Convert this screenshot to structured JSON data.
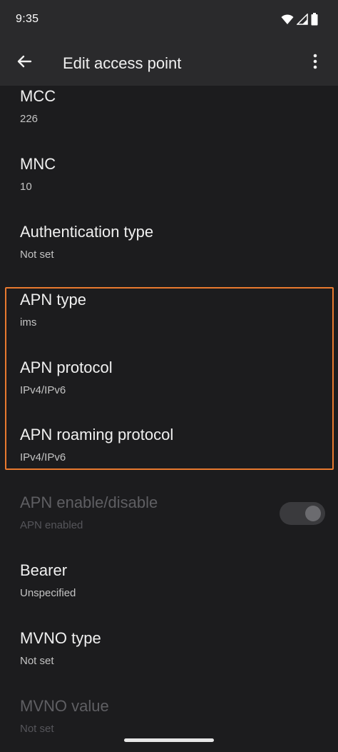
{
  "status_bar": {
    "time": "9:35",
    "icons": [
      "wifi-icon",
      "signal-icon",
      "battery-icon"
    ]
  },
  "app_bar": {
    "title": "Edit access point",
    "back_icon": "arrow-back-icon",
    "menu_icon": "more-vert-icon"
  },
  "preferences": [
    {
      "title": "MCC",
      "summary": "226"
    },
    {
      "title": "MNC",
      "summary": "10"
    },
    {
      "title": "Authentication type",
      "summary": "Not set"
    },
    {
      "title": "APN type",
      "summary": "ims"
    },
    {
      "title": "APN protocol",
      "summary": "IPv4/IPv6"
    },
    {
      "title": "APN roaming protocol",
      "summary": "IPv4/IPv6"
    },
    {
      "title": "APN enable/disable",
      "summary": "APN enabled",
      "enabled": false,
      "toggle_on": true
    },
    {
      "title": "Bearer",
      "summary": "Unspecified"
    },
    {
      "title": "MVNO type",
      "summary": "Not set"
    },
    {
      "title": "MVNO value",
      "summary": "Not set",
      "enabled": false
    }
  ],
  "colors": {
    "background": "#1c1c1e",
    "app_bar": "#2a2a2c",
    "highlight": "#e9792f"
  }
}
